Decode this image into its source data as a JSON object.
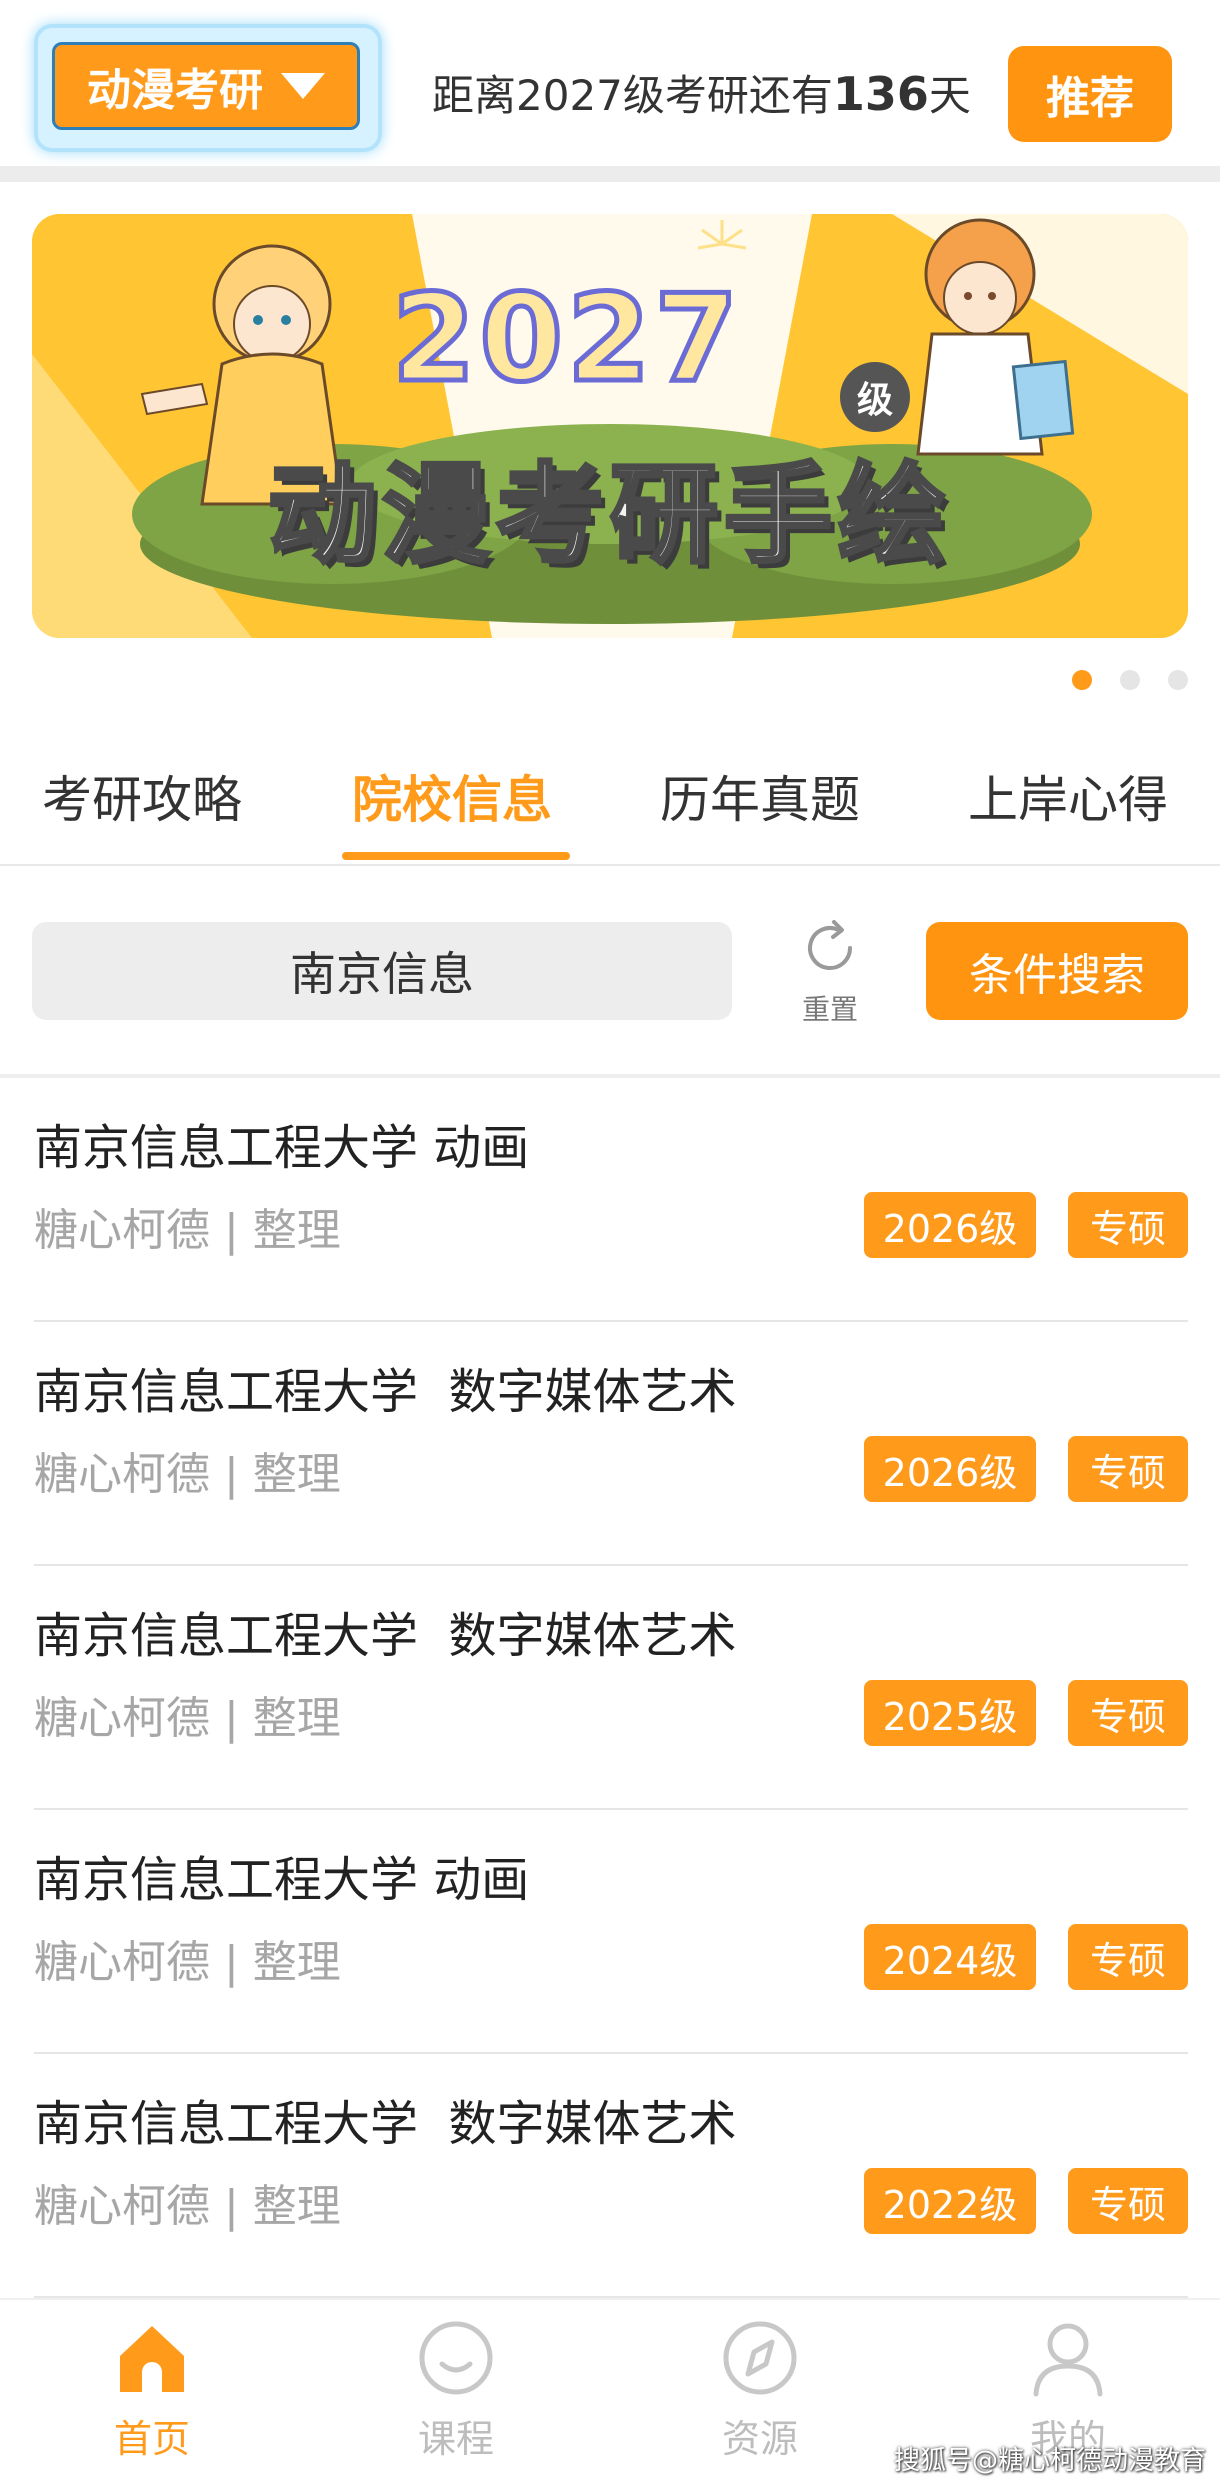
{
  "header": {
    "brand_label": "动漫考研",
    "countdown_prefix": "距离2027级考研还有",
    "countdown_days": "136",
    "countdown_suffix": "天",
    "recommend_label": "推荐"
  },
  "banner": {
    "year_text": "2027",
    "level_text": "级",
    "title_text": "动漫考研手绘",
    "slides_total": 3,
    "slide_active": 1
  },
  "tabs": [
    {
      "label": "考研攻略",
      "active": false
    },
    {
      "label": "院校信息",
      "active": true
    },
    {
      "label": "历年真题",
      "active": false
    },
    {
      "label": "上岸心得",
      "active": false
    }
  ],
  "search": {
    "value": "南京信息",
    "reset_label": "重置",
    "condition_button": "条件搜索"
  },
  "list": [
    {
      "title": "南京信息工程大学 动画",
      "meta": "糖心柯德 | 整理",
      "year": "2026级",
      "type": "专硕"
    },
    {
      "title": "南京信息工程大学  数字媒体艺术",
      "meta": "糖心柯德 | 整理",
      "year": "2026级",
      "type": "专硕"
    },
    {
      "title": "南京信息工程大学  数字媒体艺术",
      "meta": "糖心柯德 | 整理",
      "year": "2025级",
      "type": "专硕"
    },
    {
      "title": "南京信息工程大学 动画",
      "meta": "糖心柯德 | 整理",
      "year": "2024级",
      "type": "专硕"
    },
    {
      "title": "南京信息工程大学  数字媒体艺术",
      "meta": "糖心柯德 | 整理",
      "year": "2022级",
      "type": "专硕"
    }
  ],
  "bottom_nav": [
    {
      "label": "首页",
      "icon": "home-icon",
      "active": true
    },
    {
      "label": "课程",
      "icon": "smile-icon",
      "active": false
    },
    {
      "label": "资源",
      "icon": "compass-icon",
      "active": false
    },
    {
      "label": "我的",
      "icon": "user-icon",
      "active": false
    }
  ],
  "watermark": "搜狐号@糖心柯德动漫教育",
  "colors": {
    "accent": "#ff9a1a",
    "accent_dark": "#ff9410",
    "muted_text": "#a6a6a6",
    "banner_bg": "#ffc533"
  }
}
